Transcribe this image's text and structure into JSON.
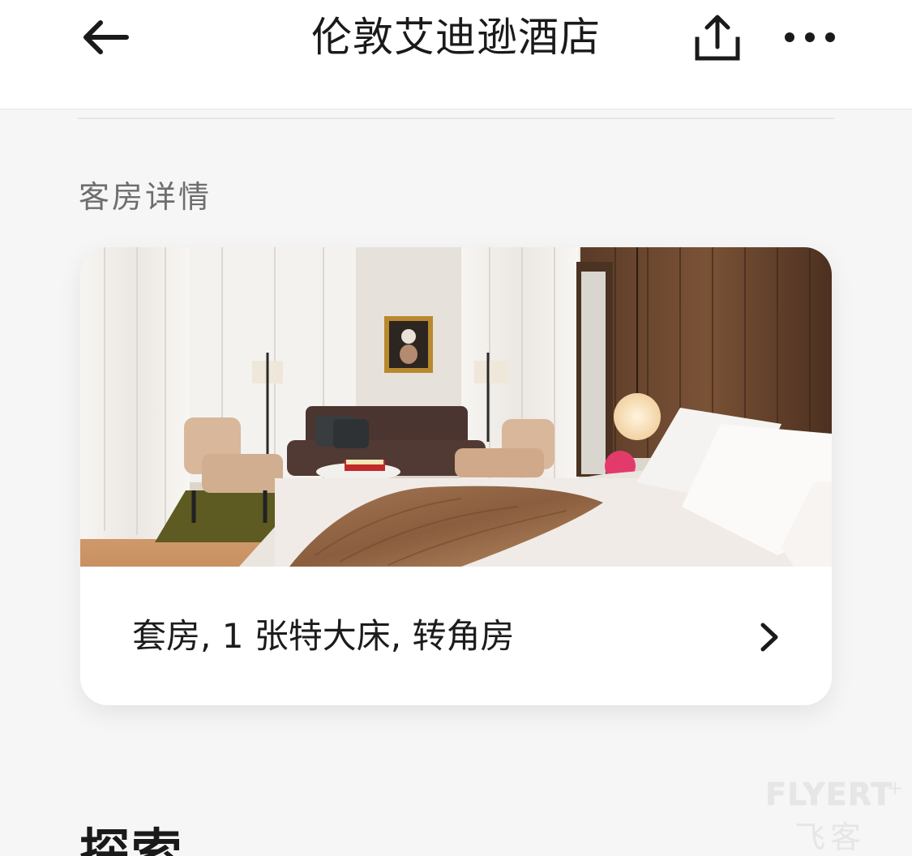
{
  "header": {
    "title": "伦敦艾迪逊酒店",
    "back_icon": "arrow-left-icon",
    "share_icon": "share-icon",
    "more_icon": "more-horizontal-icon"
  },
  "room_details": {
    "section_title": "客房详情",
    "room_name": "套房, 1 张特大床, 转角房",
    "chevron_icon": "chevron-right-icon"
  },
  "explore": {
    "title": "探索"
  },
  "watermark": {
    "brand": "FLYERT",
    "plus": "+",
    "sub": "飞客"
  },
  "colors": {
    "header_bg": "#ffffff",
    "page_bg": "#f6f6f6",
    "card_bg": "#ffffff",
    "section_title": "#6e6e6e",
    "text": "#1a1a1a"
  }
}
